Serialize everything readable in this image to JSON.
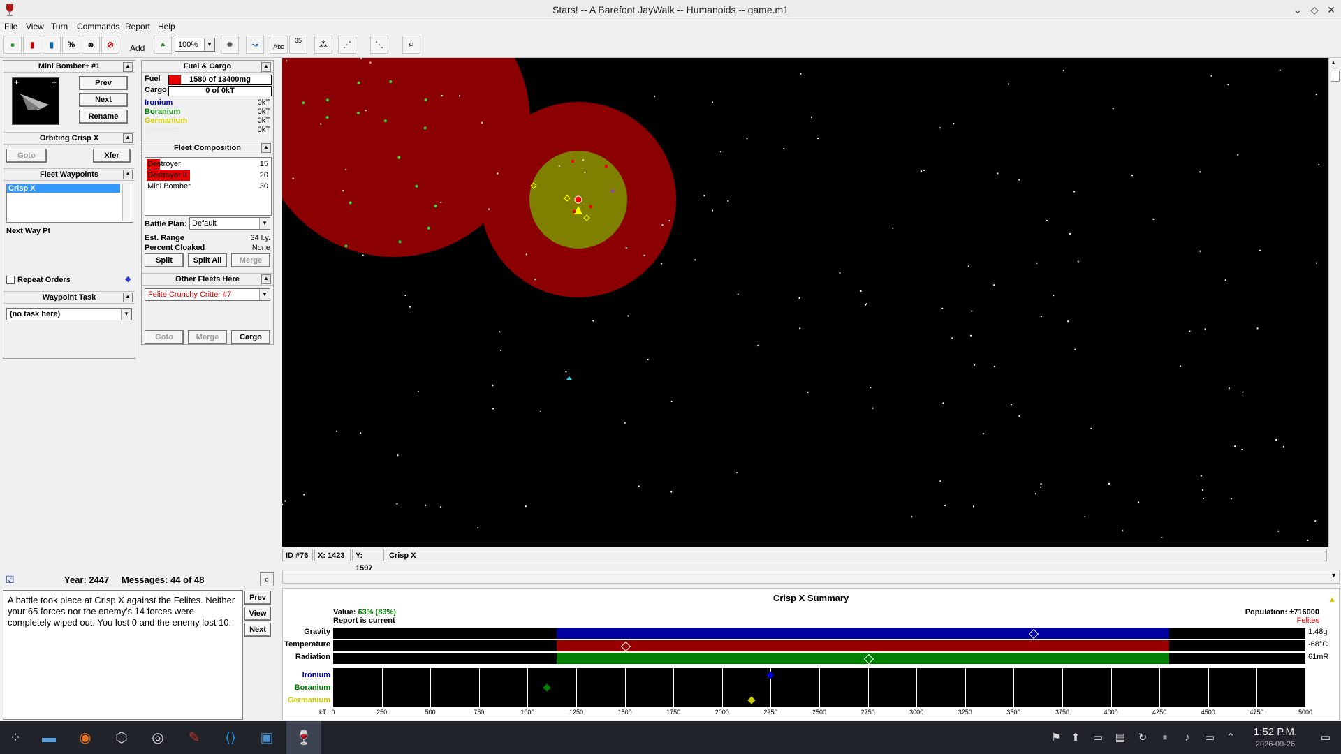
{
  "window": {
    "title": "Stars! -- A Barefoot JayWalk -- Humanoids -- game.m1"
  },
  "menu": [
    "File",
    "View",
    "Turn",
    "Commands",
    "Report",
    "Help"
  ],
  "toolbar": {
    "zoom": "100%",
    "add_label": "Add",
    "num_label": "35",
    "abc_label": "Abc"
  },
  "fleet": {
    "name": "Mini Bomber+ #1",
    "prev": "Prev",
    "next": "Next",
    "rename": "Rename",
    "orbiting": "Orbiting Crisp X",
    "goto": "Goto",
    "xfer": "Xfer",
    "waypoints_title": "Fleet Waypoints",
    "waypoints": [
      "Crisp X"
    ],
    "next_way_pt": "Next Way Pt",
    "repeat_orders": "Repeat Orders",
    "task_title": "Waypoint Task",
    "task_value": "(no task here)"
  },
  "cargo": {
    "title": "Fuel & Cargo",
    "fuel_label": "Fuel",
    "fuel_value": "1580 of 13400mg",
    "fuel_fraction": 0.118,
    "cargo_label": "Cargo",
    "cargo_value": "0 of 0kT",
    "minerals": [
      {
        "name": "Ironium",
        "value": "0kT",
        "color": "#0000cc"
      },
      {
        "name": "Boranium",
        "value": "0kT",
        "color": "#008000"
      },
      {
        "name": "Germanium",
        "value": "0kT",
        "color": "#cccc00"
      },
      {
        "name": "Colonists",
        "value": "0kT",
        "color": "#e8e8e8"
      }
    ]
  },
  "composition": {
    "title": "Fleet Composition",
    "ships": [
      {
        "name": "Destroyer",
        "count": "15",
        "damage": 0.3
      },
      {
        "name": "Destroyer II",
        "count": "20",
        "damage": 1.0
      },
      {
        "name": "Mini Bomber",
        "count": "30",
        "damage": 0
      }
    ],
    "battle_plan_label": "Battle Plan:",
    "battle_plan": "Default",
    "est_range_label": "Est. Range",
    "est_range": "34 l.y.",
    "cloaked_label": "Percent Cloaked",
    "cloaked": "None",
    "split": "Split",
    "split_all": "Split All",
    "merge": "Merge"
  },
  "other_fleets": {
    "title": "Other Fleets Here",
    "selected": "Felite Crunchy Critter #7",
    "goto": "Goto",
    "merge": "Merge",
    "cargo": "Cargo"
  },
  "map_status": {
    "id": "ID #76",
    "x": "X: 1423",
    "y": "Y: 1597",
    "name": "Crisp X"
  },
  "messages": {
    "year": "Year: 2447",
    "count": "Messages: 44 of 48",
    "text": "A battle took place at Crisp X against the Felites. Neither your 65 forces nor the enemy's 14 forces were completely wiped out. You lost 0 and the enemy lost 10.",
    "prev": "Prev",
    "view": "View",
    "next": "Next"
  },
  "summary": {
    "title": "Crisp X Summary",
    "value_label": "Value:",
    "value": "63% (83%)",
    "report": "Report is current",
    "population": "Population: ±716000",
    "owner": "Felites",
    "habs": [
      {
        "name": "Gravity",
        "value": "1.48g",
        "color": "#0000a0",
        "lo": 0.23,
        "hi": 0.86,
        "mark": 0.72
      },
      {
        "name": "Temperature",
        "value": "-68°C",
        "color": "#9a0000",
        "lo": 0.23,
        "hi": 0.86,
        "mark": 0.3
      },
      {
        "name": "Radiation",
        "value": "61mR",
        "color": "#008000",
        "lo": 0.23,
        "hi": 0.86,
        "mark": 0.55
      }
    ],
    "mineral_names": [
      {
        "name": "Ironium",
        "color": "#0000cc"
      },
      {
        "name": "Boranium",
        "color": "#008000"
      },
      {
        "name": "Germanium",
        "color": "#cccc00"
      }
    ],
    "minerals": {
      "ironium": 2250,
      "boranium": 1100,
      "germanium": 2150
    },
    "axis_unit": "kT",
    "ticks": [
      "0",
      "250",
      "500",
      "750",
      "1000",
      "1250",
      "1500",
      "1750",
      "2000",
      "2250",
      "2500",
      "2750",
      "3000",
      "3250",
      "3500",
      "3750",
      "4000",
      "4250",
      "4500",
      "4750",
      "5000"
    ]
  },
  "clock": {
    "time": "1:52 P.M.",
    "date": "2026-09-26"
  }
}
